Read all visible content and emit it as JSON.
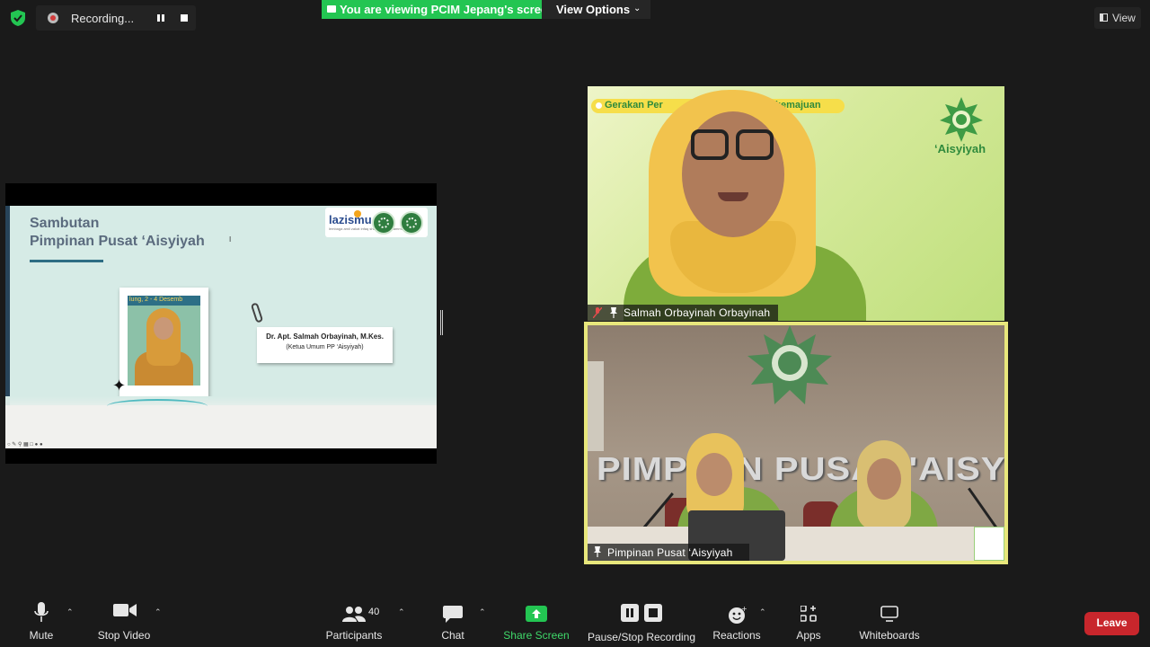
{
  "recording": {
    "label": "Recording..."
  },
  "share_banner": {
    "text": "You are viewing PCIM Jepang's screen",
    "options_label": "View Options"
  },
  "view_button": {
    "label": "View"
  },
  "slide": {
    "title_line1": "Sambutan",
    "title_line2": "Pimpinan Pusat ‘Aisyiyah",
    "logo_text": "lazismu",
    "logo_sub": "lembaga amil zakat infaq shadaqah muhammadiyah",
    "photo_caption": "lung, 2 - 4 Desemb",
    "speaker_name": "Dr. Apt. Salmah Orbayinah, M.Kes.",
    "speaker_role": "(Ketua Umum PP ‘Aisyiyah)"
  },
  "participants_video": [
    {
      "name": "Salmah Orbayinah Orbayinah",
      "banner_text": "Gerakan Per",
      "banner_text2": "kemajuan",
      "emblem_label": "‘Aisyiyah",
      "muted": true
    },
    {
      "name": "Pimpinan Pusat ‘Aisyiyah",
      "wall_text": "PIMPIN  N PUSAT 'AISYIYAH",
      "active_speaker": true
    }
  ],
  "toolbar": {
    "mute": "Mute",
    "stop_video": "Stop Video",
    "participants": "Participants",
    "participants_count": "40",
    "chat": "Chat",
    "share_screen": "Share Screen",
    "pause_stop_recording": "Pause/Stop Recording",
    "reactions": "Reactions",
    "apps": "Apps",
    "whiteboards": "Whiteboards",
    "leave": "Leave"
  },
  "colors": {
    "background": "#1a1a1a",
    "share_banner": "#23c552",
    "leave": "#c8262c",
    "active_speaker_border": "#e8e77c",
    "share_screen_icon": "#23c552"
  }
}
